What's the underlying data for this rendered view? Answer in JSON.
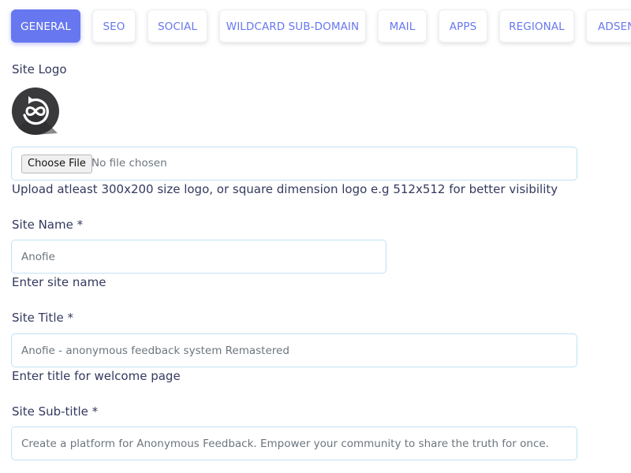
{
  "tabs": [
    {
      "label": "GENERAL",
      "active": true
    },
    {
      "label": "SEO",
      "active": false
    },
    {
      "label": "SOCIAL",
      "active": false
    },
    {
      "label": "WILDCARD SUB-DOMAIN",
      "active": false
    },
    {
      "label": "MAIL",
      "active": false
    },
    {
      "label": "APPS",
      "active": false
    },
    {
      "label": "REGIONAL",
      "active": false
    },
    {
      "label": "ADSEN",
      "active": false
    }
  ],
  "site_logo": {
    "label": "Site Logo",
    "icon": "infinity-refresh-icon",
    "choose_file_label": "Choose File",
    "no_file_text": "No file chosen",
    "help": "Upload atleast 300x200 size logo, or square dimension logo e.g 512x512 for better visibility"
  },
  "site_name": {
    "label": "Site Name *",
    "value": "Anofie",
    "help": "Enter site name"
  },
  "site_title": {
    "label": "Site Title *",
    "value": "Anofie - anonymous feedback system Remastered",
    "help": "Enter title for welcome page"
  },
  "site_subtitle": {
    "label": "Site Sub-title *",
    "value": "Create a platform for Anonymous Feedback. Empower your community to share the truth for once."
  },
  "colors": {
    "accent": "#6777ef",
    "input_border": "#bfe2f5",
    "text": "#34395e",
    "muted": "#6c757d"
  }
}
